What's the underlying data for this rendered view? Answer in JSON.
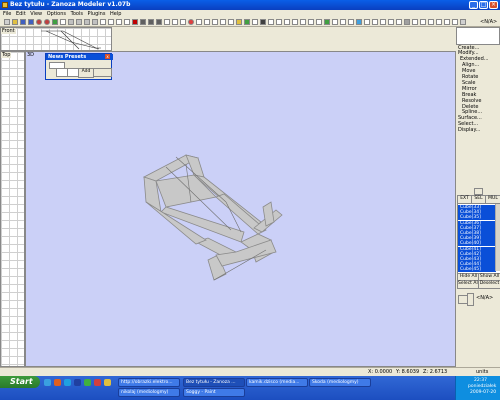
{
  "window": {
    "title": "Bez tytułu - Zanoza Modeler v1.07b"
  },
  "menu": [
    "File",
    "Edit",
    "View",
    "Options",
    "Tools",
    "Plugins",
    "Help"
  ],
  "toolbar": {
    "end_text": "<N/A>"
  },
  "viewports": {
    "front_label": "Front",
    "top_label": "Top",
    "threed_label": "3D"
  },
  "news_presets": {
    "title": "News Presets",
    "add_label": "Add",
    "close_label": "x"
  },
  "right_panel": {
    "menu_items": [
      "Create...",
      "Modify...",
      "Extended...",
      "Align...",
      "Move",
      "Rotate",
      "Scale",
      "Mirror",
      "Break",
      "Resolve",
      "Delete",
      "Spline...",
      "Surface...",
      "Select...",
      "Display..."
    ],
    "tabs": [
      "EXT",
      "SEL",
      "MUL"
    ],
    "objects": [
      "Cube[33]",
      "Cube[34]",
      "Cube[35]",
      "Cube[36]",
      "Cube[37]",
      "Cube[38]",
      "Cube[39]",
      "Cube[40]",
      "Cube[41]",
      "Cube[42]",
      "Cube[43]",
      "Cube[44]",
      "Cube[45]"
    ],
    "hide_all": "Hide All",
    "show_all": "Show All",
    "select_all": "Select All",
    "deselect": "Deselect",
    "bottom_value": "<N/A>"
  },
  "status": {
    "x": "X: 0.0000",
    "y": "Y: 8.6039",
    "z": "Z: 2.6713",
    "units": "units"
  },
  "taskbar": {
    "start": "Start",
    "tasks_row1": [
      "http://obrazki.elektro...",
      "Bez tytułu - Zanoza ...",
      "kamik.dzisco (media...",
      "Skoda (mediologmy)"
    ],
    "tasks_row2": [
      "nikolaj (mediologmy)",
      "Soggy - Paint"
    ],
    "tray_time": "22:37",
    "tray_day": "poniedziałek",
    "tray_date": "2009-07-20"
  }
}
